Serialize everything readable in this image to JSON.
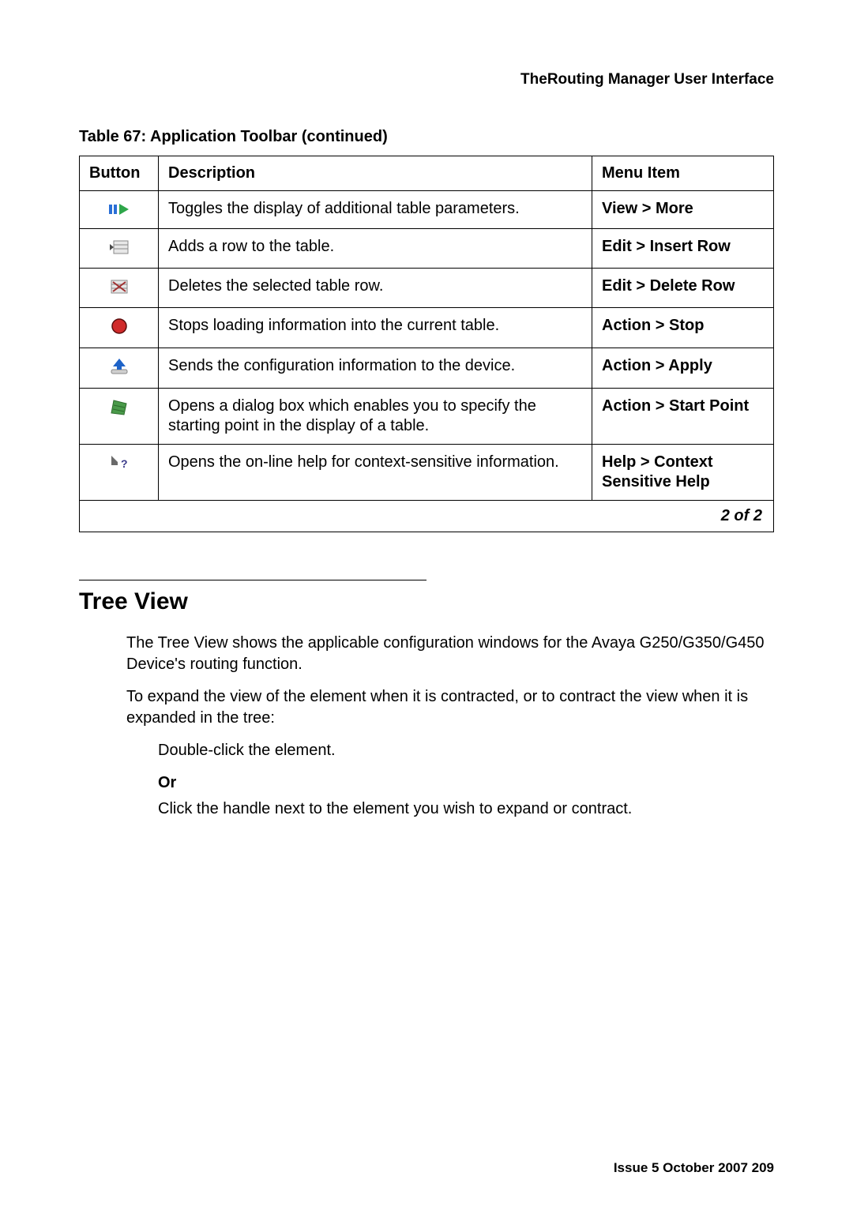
{
  "header": {
    "running_head": "TheRouting Manager User Interface"
  },
  "table": {
    "title": "Table 67: Application Toolbar (continued)",
    "columns": {
      "button": "Button",
      "description": "Description",
      "menu_item": "Menu Item"
    },
    "rows": [
      {
        "icon": "more-icon",
        "description": "Toggles the display of additional table parameters.",
        "menu_item": "View > More"
      },
      {
        "icon": "insert-row-icon",
        "description": "Adds a row to the table.",
        "menu_item": "Edit > Insert Row"
      },
      {
        "icon": "delete-row-icon",
        "description": "Deletes the selected table row.",
        "menu_item": "Edit > Delete Row"
      },
      {
        "icon": "stop-icon",
        "description": "Stops loading information into the current table.",
        "menu_item": "Action > Stop"
      },
      {
        "icon": "apply-icon",
        "description": "Sends the configuration information to the device.",
        "menu_item": "Action > Apply"
      },
      {
        "icon": "start-point-icon",
        "description": "Opens a dialog box which enables you to specify the starting point in the display of a table.",
        "menu_item": "Action > Start Point"
      },
      {
        "icon": "context-help-icon",
        "description": "Opens the on-line help for context-sensitive information.",
        "menu_item": "Help > Context Sensitive Help"
      }
    ],
    "footer": "2 of 2"
  },
  "section": {
    "heading": "Tree View",
    "para1": "The Tree View shows the applicable configuration windows for the Avaya G250/G350/G450 Device's routing function.",
    "para2": "To expand the view of the element when it is contracted, or to contract the view when it is expanded in the tree:",
    "step1": "Double-click the element.",
    "or": "Or",
    "step2": "Click the handle next to the element you wish to expand or contract."
  },
  "footer": {
    "text": "Issue 5   October 2007    209"
  }
}
